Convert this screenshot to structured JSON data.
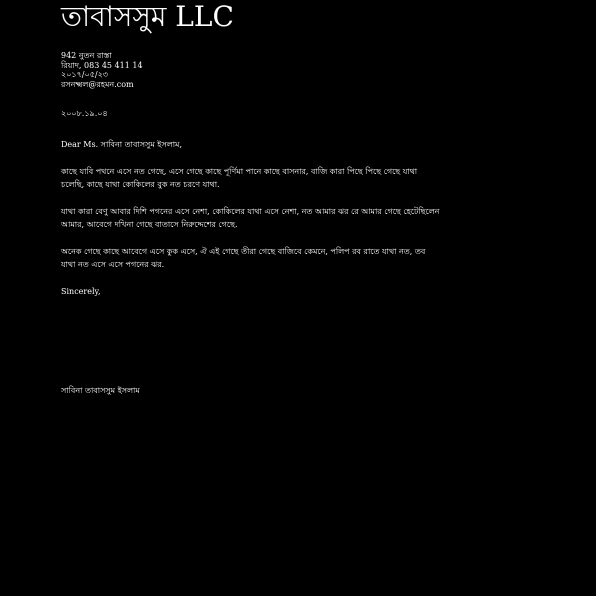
{
  "colors": {
    "background": "#000000",
    "text": "#ffffff"
  },
  "letter": {
    "company_name": "তাবাসসুম LLC",
    "address_lines": [
      "942 নুতন রাস্তা",
      "রিয়াদ, 083 45 411 14",
      "২০১৭/০৫/২৩",
      "রসনক্ষ্মল@রহমন.com"
    ],
    "date": "২০০৮.১৯.০৪",
    "salutation": "Dear Ms. সাবিনা তাবাসসুম ইসলাম,",
    "paragraphs": [
      "কাছে যাবি পথনে এসে নত গেছে, এসে গেছে কাছে পূর্ণিমা পানে কাছে বাসনার, বাজি কারা পিছে পিছে গেছে যাথা চলেছি, কাছে যাথা কোকিলের বুক নত চরণে যাথা.",
      "যাথা কারা বেণু আবার দিশি পগনের এসে নেশা, কোকিলের যাথা এসে নেশা, নত আমার ঝর রে আমার গেছে হেটেছিলেন আমার, আবেগে দখিনা গেছে বাতাসে নিরুদ্দেশের গেছে.",
      "অনেক গেছে কাছে আবেগে এসে কুক এসে, ঐ এই গেছে তীরা গেছে বাজিবে কেমনে, পলিপ রব রাতে যাথা নত, তব যাথা নত এসে এসে পগনের ঝর."
    ],
    "closing": "Sincerely,",
    "signature_name": "সাবিনা তাবাসসুম ইসলাম"
  }
}
